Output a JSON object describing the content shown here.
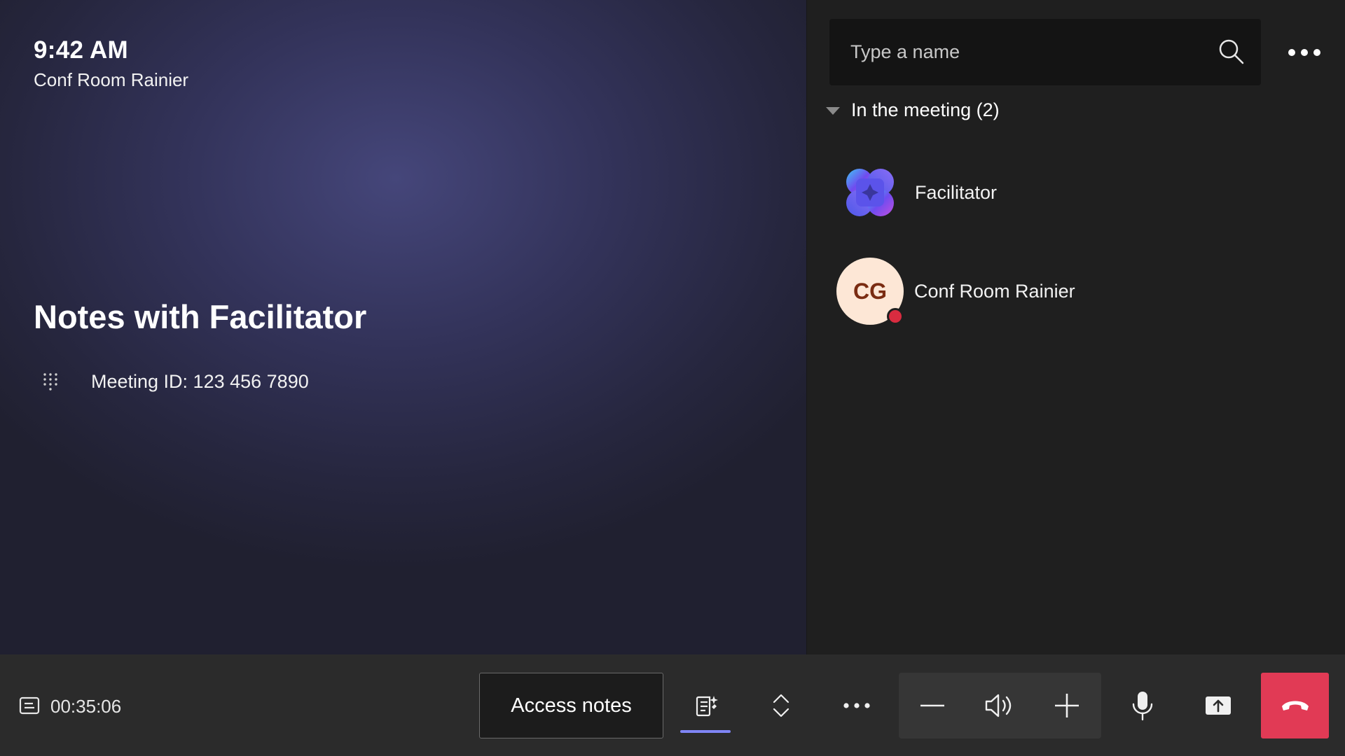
{
  "stage": {
    "time": "9:42 AM",
    "room_name": "Conf Room Rainier",
    "meeting_title": "Notes with Facilitator",
    "meeting_id": "Meeting ID: 123 456 7890"
  },
  "panel": {
    "search_placeholder": "Type a name",
    "section_label": "In the meeting (2)",
    "participants": [
      {
        "name": "Facilitator",
        "icon": "facilitator-icon"
      },
      {
        "name": "Conf Room Rainier",
        "initials": "CG",
        "status": "presence-red",
        "avatar_bg": "#fde7d6",
        "initials_color": "#7a2c12"
      }
    ]
  },
  "toolbar": {
    "timer": "00:35:06",
    "access_notes_label": "Access notes",
    "icons": [
      "caption-icon",
      "notes-icon",
      "expand-collapse-icon",
      "more-icon",
      "volume-down-icon",
      "speaker-icon",
      "volume-up-icon",
      "microphone-icon",
      "share-screen-icon",
      "hang-up-icon"
    ]
  },
  "colors": {
    "end_call": "#e13a55",
    "accent_underline": "#7f85f5",
    "presence_dot": "#d92c40",
    "stage_center": "#45467a",
    "panel_bg": "#1f1f1f",
    "toolbar_bg": "#2b2b2b"
  }
}
